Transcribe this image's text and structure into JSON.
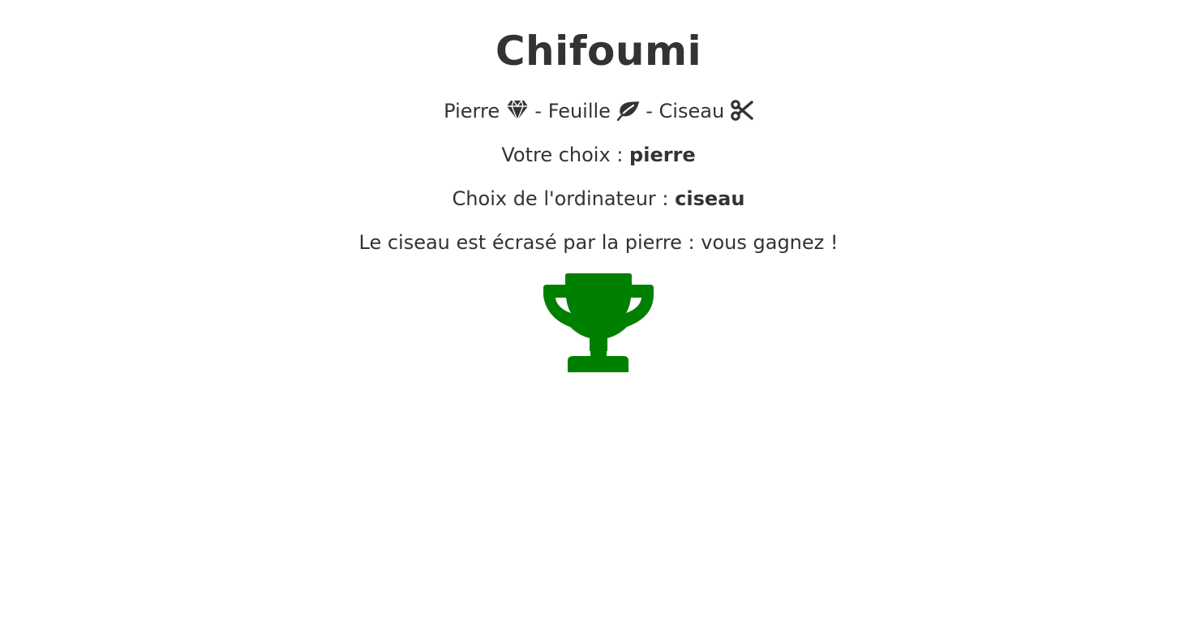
{
  "title": "Chifoumi",
  "rules": {
    "rock_label": "Pierre",
    "rock_icon": "gem-icon",
    "sep1": "-",
    "paper_label": "Feuille",
    "paper_icon": "leaf-icon",
    "sep2": "-",
    "scissors_label": "Ciseau",
    "scissors_icon": "scissors-icon"
  },
  "user_choice": {
    "label": "Votre choix :",
    "value": "pierre"
  },
  "computer_choice": {
    "label": "Choix de l'ordinateur :",
    "value": "ciseau"
  },
  "result": {
    "message": "Le ciseau est écrasé par la pierre : vous gagnez !",
    "icon": "trophy-icon",
    "icon_color": "#008000"
  },
  "colors": {
    "text": "#333333",
    "background": "#ffffff",
    "win": "#008000"
  }
}
